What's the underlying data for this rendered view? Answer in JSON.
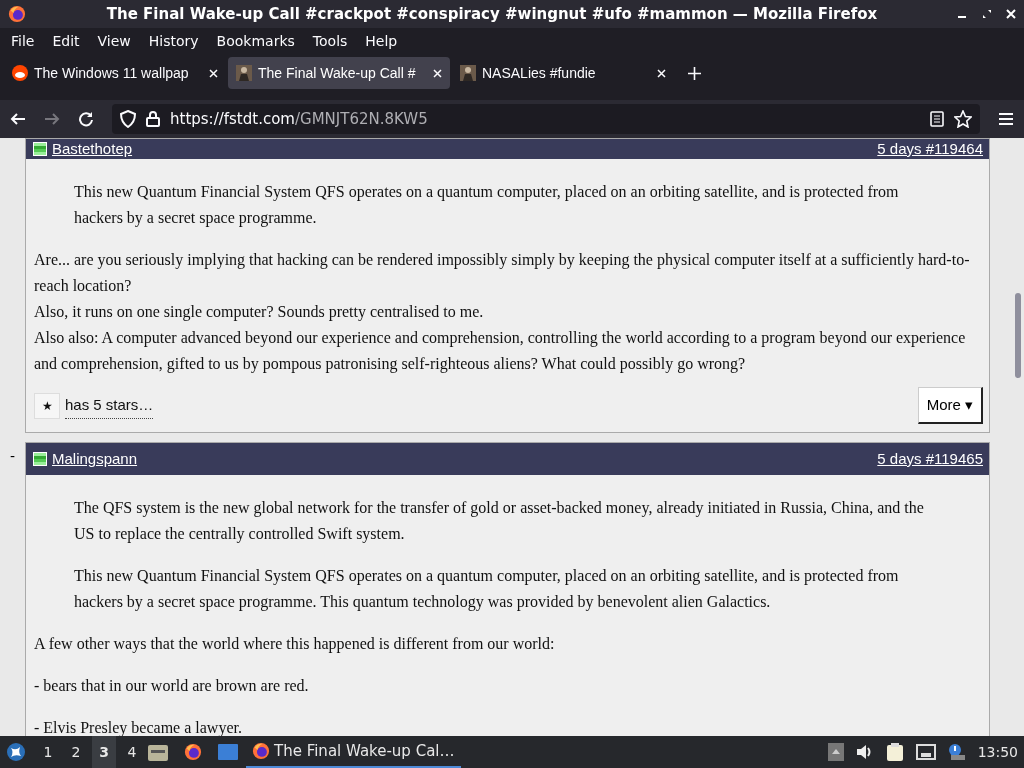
{
  "window": {
    "title": "The Final Wake-up Call #crackpot #conspiracy #wingnut #ufo #mammon — Mozilla Firefox"
  },
  "menu": [
    "File",
    "Edit",
    "View",
    "History",
    "Bookmarks",
    "Tools",
    "Help"
  ],
  "tabs": [
    {
      "label": "The Windows 11 wallpap",
      "selected": false,
      "kind": "round"
    },
    {
      "label": "The Final Wake-up Call #",
      "selected": true,
      "kind": "figure"
    },
    {
      "label": "NASALies #fundie",
      "selected": false,
      "kind": "figure"
    }
  ],
  "address": {
    "url_host": "https://fstdt.com",
    "url_path": "/GMNJT62N.8KW5"
  },
  "comments": [
    {
      "author": "Bastethotep",
      "meta": "5 days #119464",
      "blocks": [
        {
          "kind": "quote",
          "lines": [
            "This new Quantum Financial System QFS operates on a quantum computer, placed on an orbiting satellite, and is protected from hackers by a secret space programme."
          ]
        },
        {
          "kind": "text",
          "lines": [
            "Are... are you seriously implying that hacking can be rendered impossibly simply by keeping the physical computer itself at a sufficiently hard-to-reach location?",
            "Also, it runs on one single computer? Sounds pretty centralised to me.",
            "Also also: A computer advanced beyond our experience and comprehension, controlling the world according to a program beyond our experience and comprehension, gifted to us by pompous patronising self-righteous aliens? What could possibly go wrong?"
          ]
        }
      ],
      "star_button": "★",
      "stars_label": "has 5 stars…",
      "more_button": "More ▾"
    },
    {
      "author": "Malingspann",
      "meta": "5 days #119465",
      "collapse": "-",
      "blocks": [
        {
          "kind": "quote",
          "lines": [
            "The QFS system is the new global network for the transfer of gold or asset-backed money, already initiated in Russia, China, and the US to replace the centrally controlled Swift system."
          ]
        },
        {
          "kind": "quote",
          "lines": [
            "This new Quantum Financial System QFS operates on a quantum computer, placed on an orbiting satellite, and is protected from hackers by a secret space programme. This quantum technology was provided by benevolent alien Galactics."
          ]
        },
        {
          "kind": "text",
          "lines": [
            "A few other ways that the world where this happened is different from our world:"
          ]
        },
        {
          "kind": "text",
          "lines": [
            "- bears that in our world are brown are red."
          ]
        },
        {
          "kind": "text",
          "lines": [
            "- Elvis Presley became a lawyer."
          ]
        }
      ]
    }
  ],
  "taskbar": {
    "workspaces": [
      {
        "label": "1",
        "selected": false
      },
      {
        "label": "2",
        "selected": false
      },
      {
        "label": "3",
        "selected": true
      },
      {
        "label": "4",
        "selected": false
      }
    ],
    "task": "The Final Wake-up Cal…",
    "clock": "13:50"
  }
}
